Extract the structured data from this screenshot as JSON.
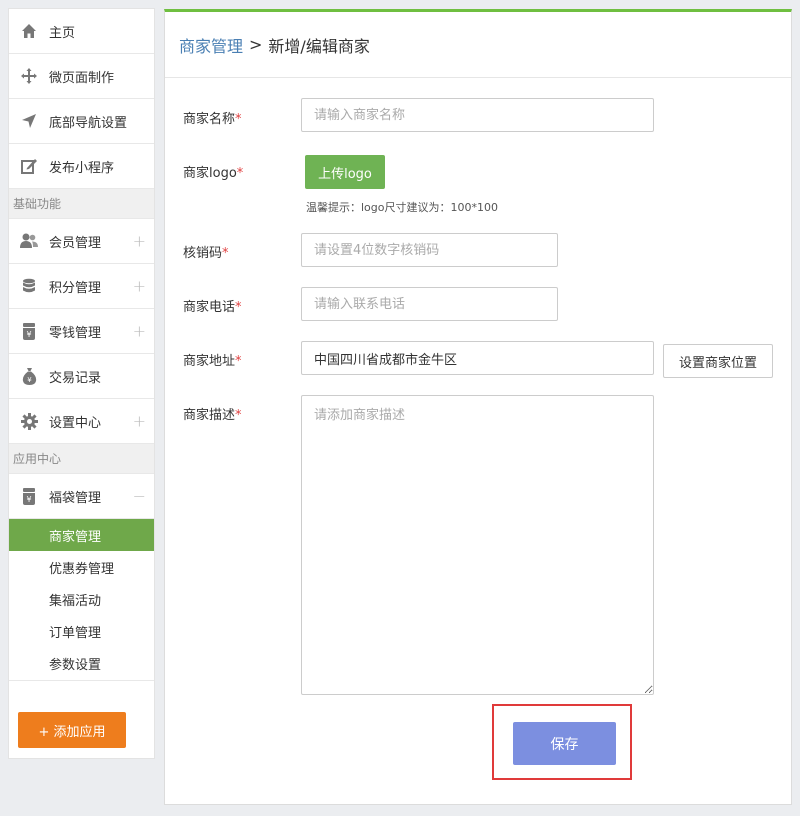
{
  "sidebar": {
    "top_items": [
      {
        "label": "主页",
        "icon": "home-icon"
      },
      {
        "label": "微页面制作",
        "icon": "move-icon"
      },
      {
        "label": "底部导航设置",
        "icon": "navigation-arrow-icon"
      },
      {
        "label": "发布小程序",
        "icon": "edit-icon"
      }
    ],
    "section_basic": "基础功能",
    "basic_items": [
      {
        "label": "会员管理",
        "icon": "users-icon",
        "expander": "+"
      },
      {
        "label": "积分管理",
        "icon": "database-icon",
        "expander": "+"
      },
      {
        "label": "零钱管理",
        "icon": "yen-jar-icon",
        "expander": "+"
      },
      {
        "label": "交易记录",
        "icon": "money-bag-icon"
      },
      {
        "label": "设置中心",
        "icon": "gear-icon",
        "expander": "+"
      }
    ],
    "section_app": "应用中心",
    "app_item": {
      "label": "福袋管理",
      "icon": "yen-jar-icon",
      "expander": "−"
    },
    "sub_items": [
      "商家管理",
      "优惠券管理",
      "集福活动",
      "订单管理",
      "参数设置"
    ],
    "add_app_label": "+ 添加应用"
  },
  "breadcrumb": {
    "link": "商家管理",
    "separator": ">",
    "current": "新增/编辑商家"
  },
  "form": {
    "name": {
      "label": "商家名称",
      "placeholder": "请输入商家名称",
      "value": ""
    },
    "logo": {
      "label": "商家logo",
      "button": "上传logo",
      "hint": "温馨提示：logo尺寸建议为：100*100"
    },
    "code": {
      "label": "核销码",
      "placeholder": "请设置4位数字核销码",
      "value": ""
    },
    "phone": {
      "label": "商家电话",
      "placeholder": "请输入联系电话",
      "value": ""
    },
    "address": {
      "label": "商家地址",
      "value": "中国四川省成都市金牛区",
      "button": "设置商家位置"
    },
    "desc": {
      "label": "商家描述",
      "placeholder": "请添加商家描述",
      "value": ""
    },
    "required_mark": "*",
    "save_label": "保存"
  },
  "colors": {
    "accent_green": "#6fa84a",
    "orange": "#ee7d1d",
    "save_blue": "#7c8fe0",
    "highlight_red": "#e03a3a"
  }
}
